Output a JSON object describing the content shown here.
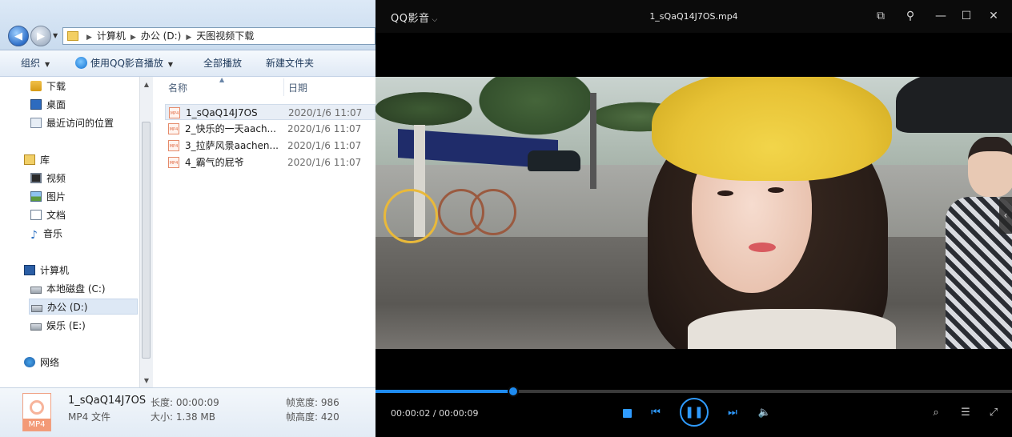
{
  "explorer": {
    "breadcrumb": [
      "计算机",
      "办公 (D:)",
      "天图视频下载"
    ],
    "toolbar": {
      "organize": "组织",
      "play_with_qq": "使用QQ影音播放",
      "play_all": "全部播放",
      "new_folder": "新建文件夹"
    },
    "nav": {
      "favorites": [
        {
          "label": "下载",
          "icon": "download-folder-icon"
        },
        {
          "label": "桌面",
          "icon": "desktop-icon"
        },
        {
          "label": "最近访问的位置",
          "icon": "recent-places-icon"
        }
      ],
      "libraries_label": "库",
      "libraries": [
        {
          "label": "视频",
          "icon": "video-library-icon"
        },
        {
          "label": "图片",
          "icon": "pictures-library-icon"
        },
        {
          "label": "文档",
          "icon": "documents-library-icon"
        },
        {
          "label": "音乐",
          "icon": "music-library-icon"
        }
      ],
      "computer_label": "计算机",
      "drives": [
        {
          "label": "本地磁盘 (C:)"
        },
        {
          "label": "办公 (D:)",
          "selected": true
        },
        {
          "label": "娱乐 (E:)"
        }
      ],
      "network_label": "网络"
    },
    "columns": {
      "name": "名称",
      "date": "日期"
    },
    "files": [
      {
        "name": "1_sQaQ14J7OS",
        "date": "2020/1/6 11:07",
        "selected": true
      },
      {
        "name": "2_快乐的一天aach...",
        "date": "2020/1/6 11:07"
      },
      {
        "name": "3_拉萨风景aachen...",
        "date": "2020/1/6 11:07"
      },
      {
        "name": "4_霸气的屁爷",
        "date": "2020/1/6 11:07"
      }
    ],
    "file_icon_text": "MP4",
    "details": {
      "name": "1_sQaQ14J7OS",
      "type": "MP4 文件",
      "length": "长度: 00:00:09",
      "size": "大小: 1.38 MB",
      "frame_width": "帧宽度: 986",
      "frame_height": "帧高度: 420",
      "icon_text": "MP4"
    }
  },
  "player": {
    "brand": "QQ影音",
    "title": "1_sQaQ14J7OS.mp4",
    "time": "00:00:02 / 00:00:09",
    "progress": 0.216,
    "accent": "#2f9bff",
    "window_icons": [
      "mini-mode-icon",
      "pin-icon",
      "minimize-icon",
      "maximize-icon",
      "close-icon"
    ],
    "right_icons": [
      "screenshot-icon",
      "settings-icon",
      "fullscreen-icon"
    ]
  }
}
